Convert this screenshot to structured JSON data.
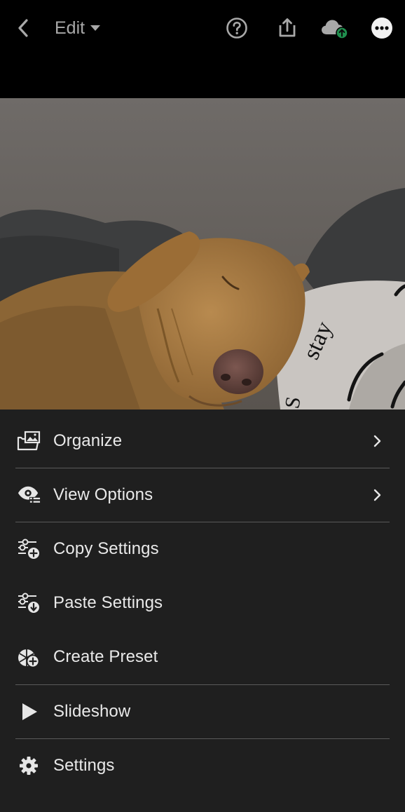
{
  "topbar": {
    "edit_label": "Edit",
    "icons": [
      "back-icon",
      "help-icon",
      "share-icon",
      "cloud-sync-icon",
      "more-icon"
    ]
  },
  "photo": {
    "description_text": "stay",
    "pillow_text": "stay"
  },
  "menu": {
    "items": [
      {
        "label": "Organize",
        "icon": "organize-icon",
        "has_submenu": true
      },
      {
        "label": "View Options",
        "icon": "view-options-icon",
        "has_submenu": true
      },
      {
        "label": "Copy Settings",
        "icon": "copy-settings-icon",
        "has_submenu": false
      },
      {
        "label": "Paste Settings",
        "icon": "paste-settings-icon",
        "has_submenu": false
      },
      {
        "label": "Create Preset",
        "icon": "create-preset-icon",
        "has_submenu": false
      },
      {
        "label": "Slideshow",
        "icon": "slideshow-icon",
        "has_submenu": false
      },
      {
        "label": "Settings",
        "icon": "settings-icon",
        "has_submenu": false
      }
    ]
  },
  "colors": {
    "background": "#000000",
    "sheet": "#1f1f1f",
    "text": "#e9e9e9",
    "muted": "#a8a8a8",
    "cloud_badge": "#1f8f4e"
  }
}
